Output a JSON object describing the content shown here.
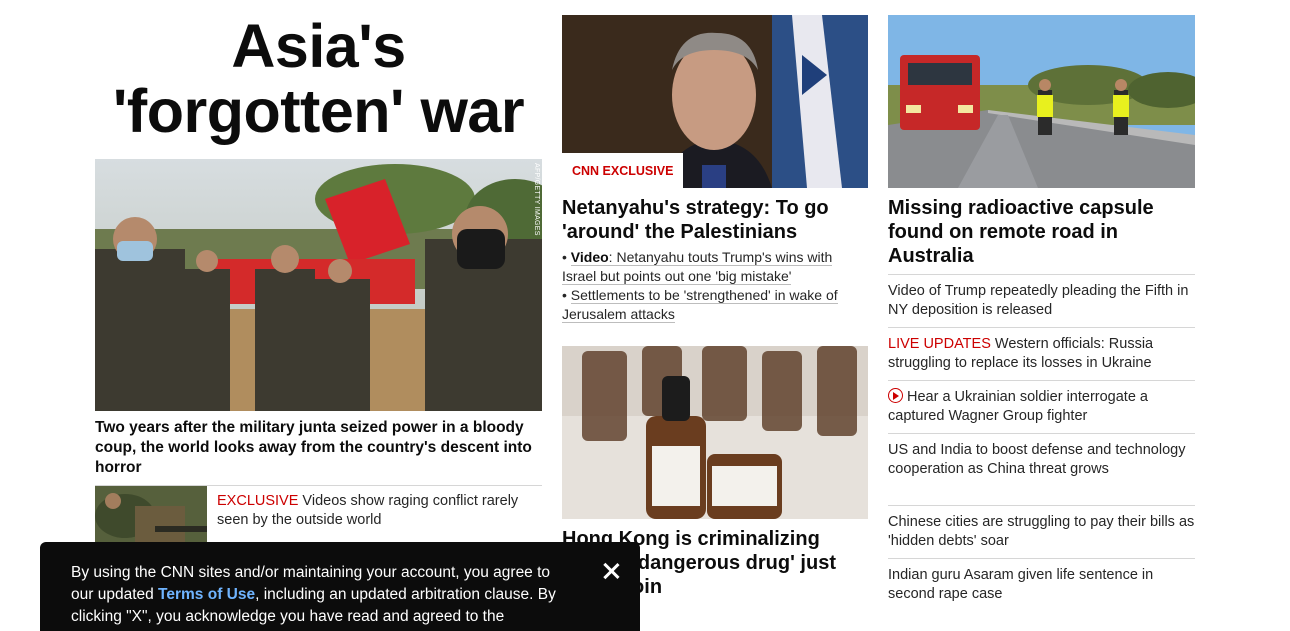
{
  "col1": {
    "headline": "Asia's 'forgotten' war",
    "hero_credit": "AFP/GETTY IMAGES",
    "hero_caption": "Two years after the military junta seized power in a bloody coup, the world looks away from the country's descent into horror",
    "sub_tag": "EXCLUSIVE",
    "sub_text": " Videos show raging conflict rarely seen by the outside world"
  },
  "col2": {
    "card1": {
      "badge": "CNN EXCLUSIVE",
      "title": "Netanyahu's strategy: To go 'around' the Palestinians",
      "bullets": [
        {
          "prefix": "Video",
          "text": "Netanyahu touts Trump's wins with Israel but points out one 'big mistake'"
        },
        {
          "prefix": "",
          "text": "Settlements to be 'strengthened' in wake of Jerusalem attacks"
        }
      ]
    },
    "card2": {
      "title": "Hong Kong is criminalizing CBD, a 'dangerous drug' just like heroin"
    }
  },
  "col3": {
    "card": {
      "title": "Missing radioactive capsule found on remote road in Australia"
    },
    "list": [
      {
        "tag": "",
        "text": "Video of Trump repeatedly pleading the Fifth in NY deposition is released"
      },
      {
        "tag": "LIVE UPDATES",
        "text": " Western officials: Russia struggling to replace its losses in Ukraine"
      },
      {
        "tag": "",
        "text": "Hear a Ukrainian soldier interrogate a captured Wagner Group fighter",
        "icon": "play-icon"
      },
      {
        "tag": "",
        "text": "US and India to boost defense and technology cooperation as China threat grows"
      },
      {
        "tag": "",
        "text": "Chinese cities are struggling to pay their bills as 'hidden debts' soar"
      },
      {
        "tag": "",
        "text": "Indian guru Asaram given life sentence in second rape case"
      }
    ]
  },
  "consent": {
    "text_before": "By using the CNN sites and/or maintaining your account, you agree to our updated ",
    "link": "Terms of Use",
    "text_after": ", including an updated arbitration clause. By clicking \"X\", you acknowledge you have read and agreed to the",
    "close_icon": "close-icon"
  },
  "colors": {
    "accent": "#cc0000",
    "link": "#6fb4ff",
    "banner": "#0c0c0c"
  }
}
